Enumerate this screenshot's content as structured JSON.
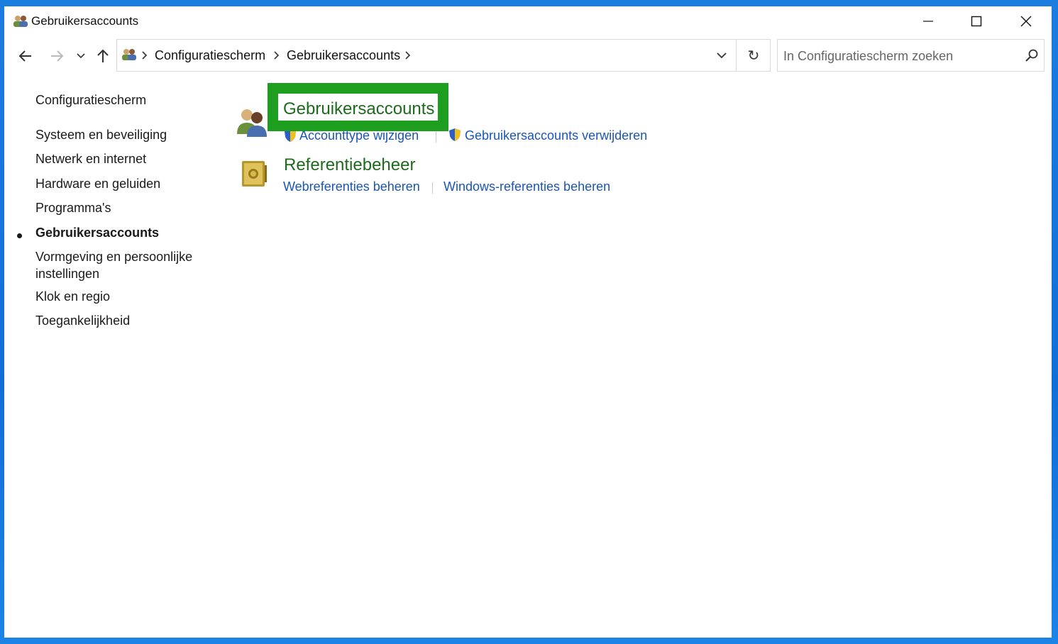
{
  "window": {
    "title": "Gebruikersaccounts",
    "controls": {
      "minimize": "minimize-icon",
      "maximize": "maximize-icon",
      "close": "close-icon"
    }
  },
  "nav": {
    "back": "back-arrow-icon",
    "forward": "forward-arrow-icon",
    "recent": "chevron-down-icon",
    "up": "up-arrow-icon"
  },
  "address": {
    "icon": "user-accounts-icon",
    "crumbs": [
      "Configuratiescherm",
      "Gebruikersaccounts"
    ],
    "dropdown": "chevron-down-icon",
    "refresh": "↻"
  },
  "search": {
    "placeholder": "In Configuratiescherm zoeken",
    "icon": "search-icon"
  },
  "sidebar": {
    "home": "Configuratiescherm",
    "items": [
      {
        "label": "Systeem en beveiliging",
        "active": false
      },
      {
        "label": "Netwerk en internet",
        "active": false
      },
      {
        "label": "Hardware en geluiden",
        "active": false
      },
      {
        "label": "Programma's",
        "active": false
      },
      {
        "label": "Gebruikersaccounts",
        "active": true
      },
      {
        "label": "Vormgeving en persoonlijke instellingen",
        "active": false
      },
      {
        "label": "Klok en regio",
        "active": false
      },
      {
        "label": "Toegankelijkheid",
        "active": false
      }
    ]
  },
  "categories": [
    {
      "title": "Gebruikersaccounts",
      "icon": "user-accounts-icon",
      "highlighted": true,
      "highlight_color": "#1e9e1e",
      "links": [
        "Accounttype wijzigen",
        "Gebruikersaccounts verwijderen"
      ]
    },
    {
      "title": "Referentiebeheer",
      "icon": "credential-vault-icon",
      "highlighted": false,
      "links": [
        "Webreferenties beheren",
        "Windows-referenties beheren"
      ]
    }
  ],
  "colors": {
    "category_title": "#1e6b1e",
    "link": "#1a56b8",
    "desktop": "#1a7de0"
  }
}
